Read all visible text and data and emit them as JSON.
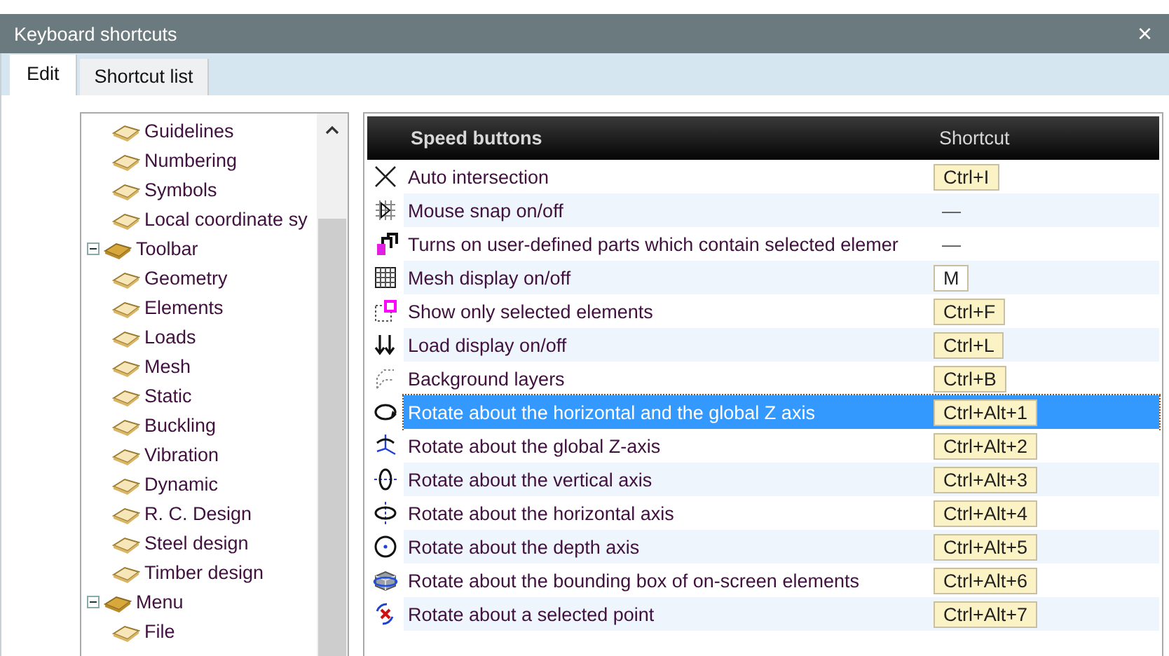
{
  "window": {
    "title": "Keyboard shortcuts",
    "close": "×"
  },
  "tabs": [
    {
      "label": "Edit",
      "selected": true
    },
    {
      "label": "Shortcut list",
      "selected": false
    }
  ],
  "tree": [
    {
      "children": [
        {
          "label": "Guidelines"
        },
        {
          "label": "Numbering"
        },
        {
          "label": "Symbols"
        },
        {
          "label": "Local coordinate sy"
        }
      ]
    },
    {
      "label": "Toolbar",
      "expanded": true,
      "children": [
        {
          "label": "Geometry"
        },
        {
          "label": "Elements"
        },
        {
          "label": "Loads"
        },
        {
          "label": "Mesh"
        },
        {
          "label": "Static"
        },
        {
          "label": "Buckling"
        },
        {
          "label": "Vibration"
        },
        {
          "label": "Dynamic"
        },
        {
          "label": "R. C. Design"
        },
        {
          "label": "Steel design"
        },
        {
          "label": "Timber design"
        }
      ]
    },
    {
      "label": "Menu",
      "expanded": true,
      "children": [
        {
          "label": "File"
        }
      ]
    }
  ],
  "table": {
    "columns": [
      "Speed buttons",
      "Shortcut"
    ],
    "rows": [
      {
        "name": "Auto intersection",
        "shortcut": "Ctrl+I",
        "kind": "default",
        "selected": false
      },
      {
        "name": "Mouse snap on/off",
        "shortcut": "—",
        "kind": "none",
        "selected": false
      },
      {
        "name": "Turns on user-defined parts which contain selected elemer",
        "shortcut": "—",
        "kind": "none",
        "selected": false
      },
      {
        "name": "Mesh display on/off",
        "shortcut": "M",
        "kind": "user",
        "selected": false
      },
      {
        "name": "Show only selected elements",
        "shortcut": "Ctrl+F",
        "kind": "default",
        "selected": false
      },
      {
        "name": "Load display on/off",
        "shortcut": "Ctrl+L",
        "kind": "default",
        "selected": false
      },
      {
        "name": "Background layers",
        "shortcut": "Ctrl+B",
        "kind": "default",
        "selected": false
      },
      {
        "name": "Rotate about the horizontal and the global Z axis",
        "shortcut": "Ctrl+Alt+1",
        "kind": "default",
        "selected": true
      },
      {
        "name": "Rotate about the global Z-axis",
        "shortcut": "Ctrl+Alt+2",
        "kind": "default",
        "selected": false
      },
      {
        "name": "Rotate about the vertical axis",
        "shortcut": "Ctrl+Alt+3",
        "kind": "default",
        "selected": false
      },
      {
        "name": "Rotate about the horizontal axis",
        "shortcut": "Ctrl+Alt+4",
        "kind": "default",
        "selected": false
      },
      {
        "name": "Rotate about the depth axis",
        "shortcut": "Ctrl+Alt+5",
        "kind": "default",
        "selected": false
      },
      {
        "name": "Rotate about the bounding box of on-screen elements",
        "shortcut": "Ctrl+Alt+6",
        "kind": "default",
        "selected": false
      },
      {
        "name": "Rotate about a selected point",
        "shortcut": "Ctrl+Alt+7",
        "kind": "default",
        "selected": false
      }
    ]
  }
}
